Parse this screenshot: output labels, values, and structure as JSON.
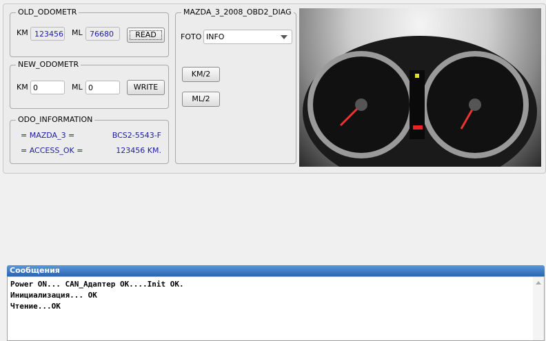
{
  "old_odometr": {
    "title": "OLD_ODOMETR",
    "km_label": "KM",
    "km_value": "123456",
    "ml_label": "ML",
    "ml_value": "76680",
    "read_button": "READ"
  },
  "new_odometr": {
    "title": "NEW_ODOMETR",
    "km_label": "KM",
    "km_value": "0",
    "ml_label": "ML",
    "ml_value": "0",
    "write_button": "WRITE"
  },
  "odo_information": {
    "title": "ODO_INFORMATION",
    "rows": [
      {
        "left": "= MAZDA_3 =",
        "right": "BCS2-5543-F"
      },
      {
        "left": "= ACCESS_OK =",
        "right": "123456 KM."
      }
    ]
  },
  "diag": {
    "title": "MAZDA_3_2008_OBD2_DIAG",
    "foto_label": "FOTO",
    "foto_value": "INFO",
    "km2_button": "KM/2",
    "ml2_button": "ML/2"
  },
  "messages": {
    "title": "Сообщения",
    "lines": [
      "Power ON... CAN_Адаптер OK....Init OK.",
      "Инициализация... OK",
      "Чтение...OK"
    ]
  }
}
